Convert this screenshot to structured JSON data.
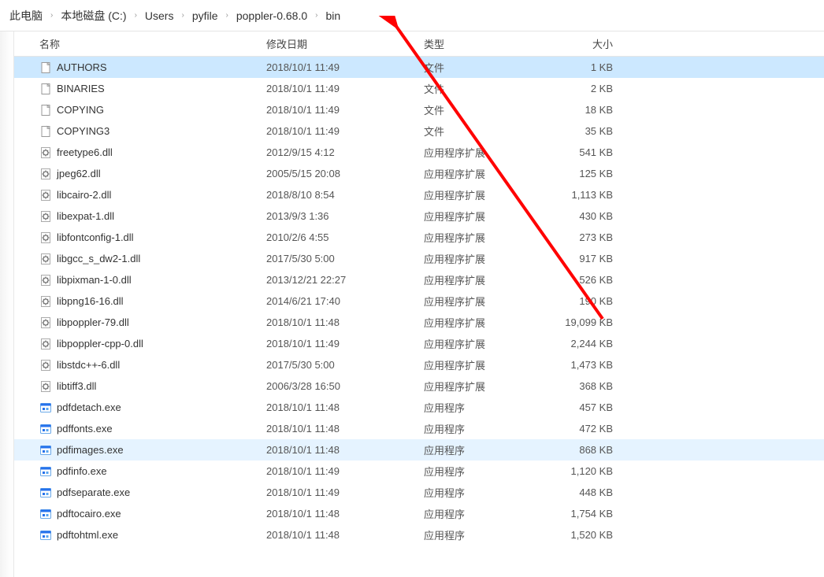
{
  "breadcrumb": {
    "items": [
      {
        "label": "此电脑"
      },
      {
        "label": "本地磁盘 (C:)"
      },
      {
        "label": "Users"
      },
      {
        "label": "pyfile"
      },
      {
        "label": "poppler-0.68.0"
      },
      {
        "label": "bin"
      }
    ]
  },
  "columns": {
    "name": "名称",
    "date": "修改日期",
    "type": "类型",
    "size": "大小"
  },
  "files": [
    {
      "name": "AUTHORS",
      "date": "2018/10/1 11:49",
      "type": "文件",
      "size": "1 KB",
      "icon": "file",
      "sel": "main"
    },
    {
      "name": "BINARIES",
      "date": "2018/10/1 11:49",
      "type": "文件",
      "size": "2 KB",
      "icon": "file"
    },
    {
      "name": "COPYING",
      "date": "2018/10/1 11:49",
      "type": "文件",
      "size": "18 KB",
      "icon": "file"
    },
    {
      "name": "COPYING3",
      "date": "2018/10/1 11:49",
      "type": "文件",
      "size": "35 KB",
      "icon": "file"
    },
    {
      "name": "freetype6.dll",
      "date": "2012/9/15 4:12",
      "type": "应用程序扩展",
      "size": "541 KB",
      "icon": "dll"
    },
    {
      "name": "jpeg62.dll",
      "date": "2005/5/15 20:08",
      "type": "应用程序扩展",
      "size": "125 KB",
      "icon": "dll"
    },
    {
      "name": "libcairo-2.dll",
      "date": "2018/8/10 8:54",
      "type": "应用程序扩展",
      "size": "1,113 KB",
      "icon": "dll"
    },
    {
      "name": "libexpat-1.dll",
      "date": "2013/9/3 1:36",
      "type": "应用程序扩展",
      "size": "430 KB",
      "icon": "dll"
    },
    {
      "name": "libfontconfig-1.dll",
      "date": "2010/2/6 4:55",
      "type": "应用程序扩展",
      "size": "273 KB",
      "icon": "dll"
    },
    {
      "name": "libgcc_s_dw2-1.dll",
      "date": "2017/5/30 5:00",
      "type": "应用程序扩展",
      "size": "917 KB",
      "icon": "dll"
    },
    {
      "name": "libpixman-1-0.dll",
      "date": "2013/12/21 22:27",
      "type": "应用程序扩展",
      "size": "526 KB",
      "icon": "dll"
    },
    {
      "name": "libpng16-16.dll",
      "date": "2014/6/21 17:40",
      "type": "应用程序扩展",
      "size": "190 KB",
      "icon": "dll"
    },
    {
      "name": "libpoppler-79.dll",
      "date": "2018/10/1 11:48",
      "type": "应用程序扩展",
      "size": "19,099 KB",
      "icon": "dll"
    },
    {
      "name": "libpoppler-cpp-0.dll",
      "date": "2018/10/1 11:49",
      "type": "应用程序扩展",
      "size": "2,244 KB",
      "icon": "dll"
    },
    {
      "name": "libstdc++-6.dll",
      "date": "2017/5/30 5:00",
      "type": "应用程序扩展",
      "size": "1,473 KB",
      "icon": "dll"
    },
    {
      "name": "libtiff3.dll",
      "date": "2006/3/28 16:50",
      "type": "应用程序扩展",
      "size": "368 KB",
      "icon": "dll"
    },
    {
      "name": "pdfdetach.exe",
      "date": "2018/10/1 11:48",
      "type": "应用程序",
      "size": "457 KB",
      "icon": "exe"
    },
    {
      "name": "pdffonts.exe",
      "date": "2018/10/1 11:48",
      "type": "应用程序",
      "size": "472 KB",
      "icon": "exe"
    },
    {
      "name": "pdfimages.exe",
      "date": "2018/10/1 11:48",
      "type": "应用程序",
      "size": "868 KB",
      "icon": "exe",
      "sel": "soft"
    },
    {
      "name": "pdfinfo.exe",
      "date": "2018/10/1 11:49",
      "type": "应用程序",
      "size": "1,120 KB",
      "icon": "exe"
    },
    {
      "name": "pdfseparate.exe",
      "date": "2018/10/1 11:49",
      "type": "应用程序",
      "size": "448 KB",
      "icon": "exe"
    },
    {
      "name": "pdftocairo.exe",
      "date": "2018/10/1 11:48",
      "type": "应用程序",
      "size": "1,754 KB",
      "icon": "exe"
    },
    {
      "name": "pdftohtml.exe",
      "date": "2018/10/1 11:48",
      "type": "应用程序",
      "size": "1,520 KB",
      "icon": "exe"
    }
  ]
}
